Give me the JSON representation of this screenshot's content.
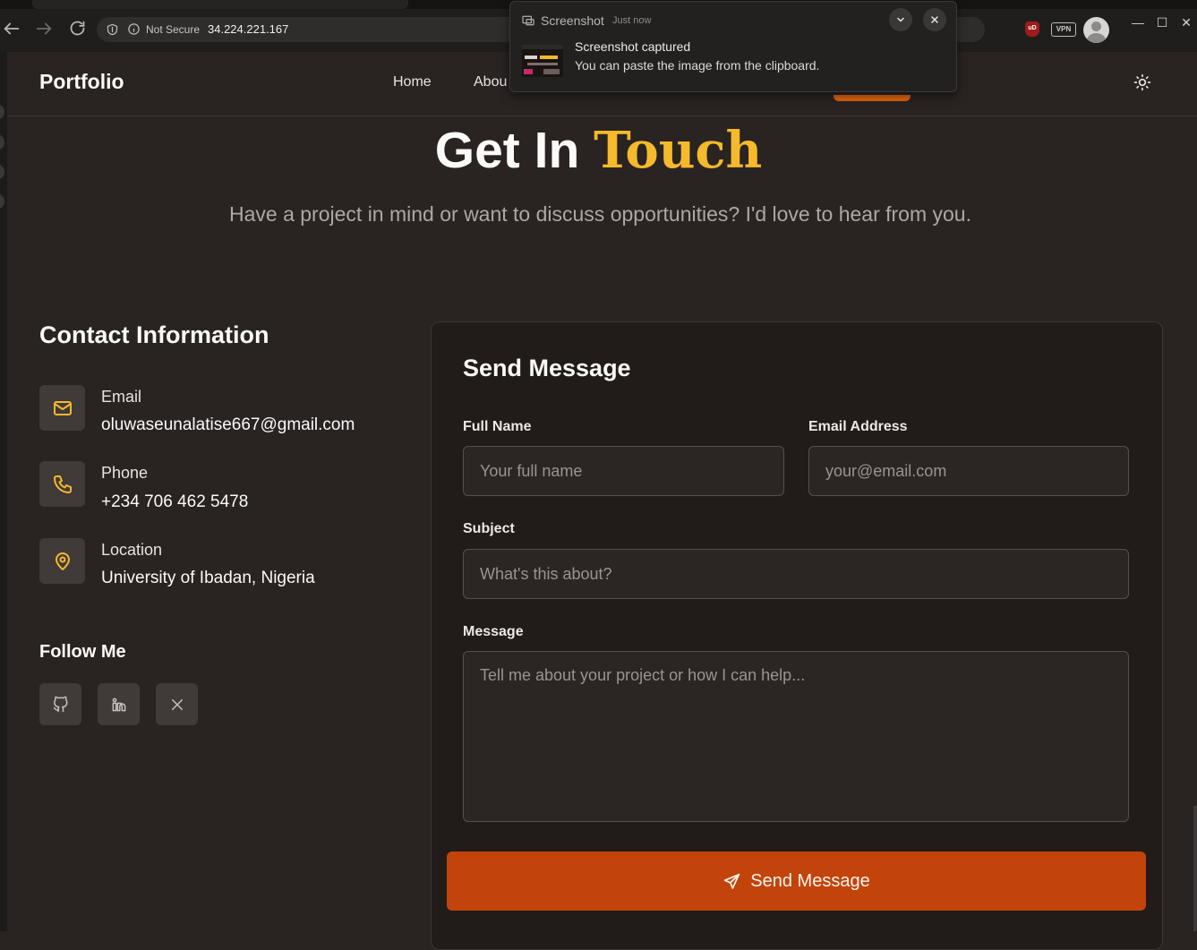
{
  "browser": {
    "security_label": "Not Secure",
    "url": "34.224.221.167",
    "ublock_label": "uD",
    "vpn_label": "VPN",
    "window_controls": [
      "—",
      "☐",
      "✕"
    ]
  },
  "toast": {
    "app_name": "Screenshot",
    "time": "Just now",
    "title": "Screenshot captured",
    "body": "You can paste the image from the clipboard."
  },
  "site": {
    "brand": "Portfolio",
    "nav": [
      "Home",
      "Abou"
    ],
    "accent_color": "#f5b92c",
    "button_color": "#c2440a"
  },
  "hero": {
    "title_plain": "Get In",
    "title_accent": "Touch",
    "subtitle": "Have a project in mind or want to discuss opportunities? I'd love to hear from you."
  },
  "contact": {
    "heading": "Contact Information",
    "items": [
      {
        "icon": "mail-icon",
        "label": "Email",
        "value": "oluwaseunalatise667@gmail.com"
      },
      {
        "icon": "phone-icon",
        "label": "Phone",
        "value": "+234 706 462 5478"
      },
      {
        "icon": "map-pin-icon",
        "label": "Location",
        "value": "University of Ibadan, Nigeria"
      }
    ],
    "follow_heading": "Follow Me",
    "socials": [
      "github-icon",
      "linkedin-icon",
      "x-icon"
    ]
  },
  "form": {
    "title": "Send Message",
    "full_name_label": "Full Name",
    "full_name_placeholder": "Your full name",
    "email_label": "Email Address",
    "email_placeholder": "your@email.com",
    "subject_label": "Subject",
    "subject_placeholder": "What's this about?",
    "message_label": "Message",
    "message_placeholder": "Tell me about your project or how I can help...",
    "submit_label": "Send Message"
  }
}
